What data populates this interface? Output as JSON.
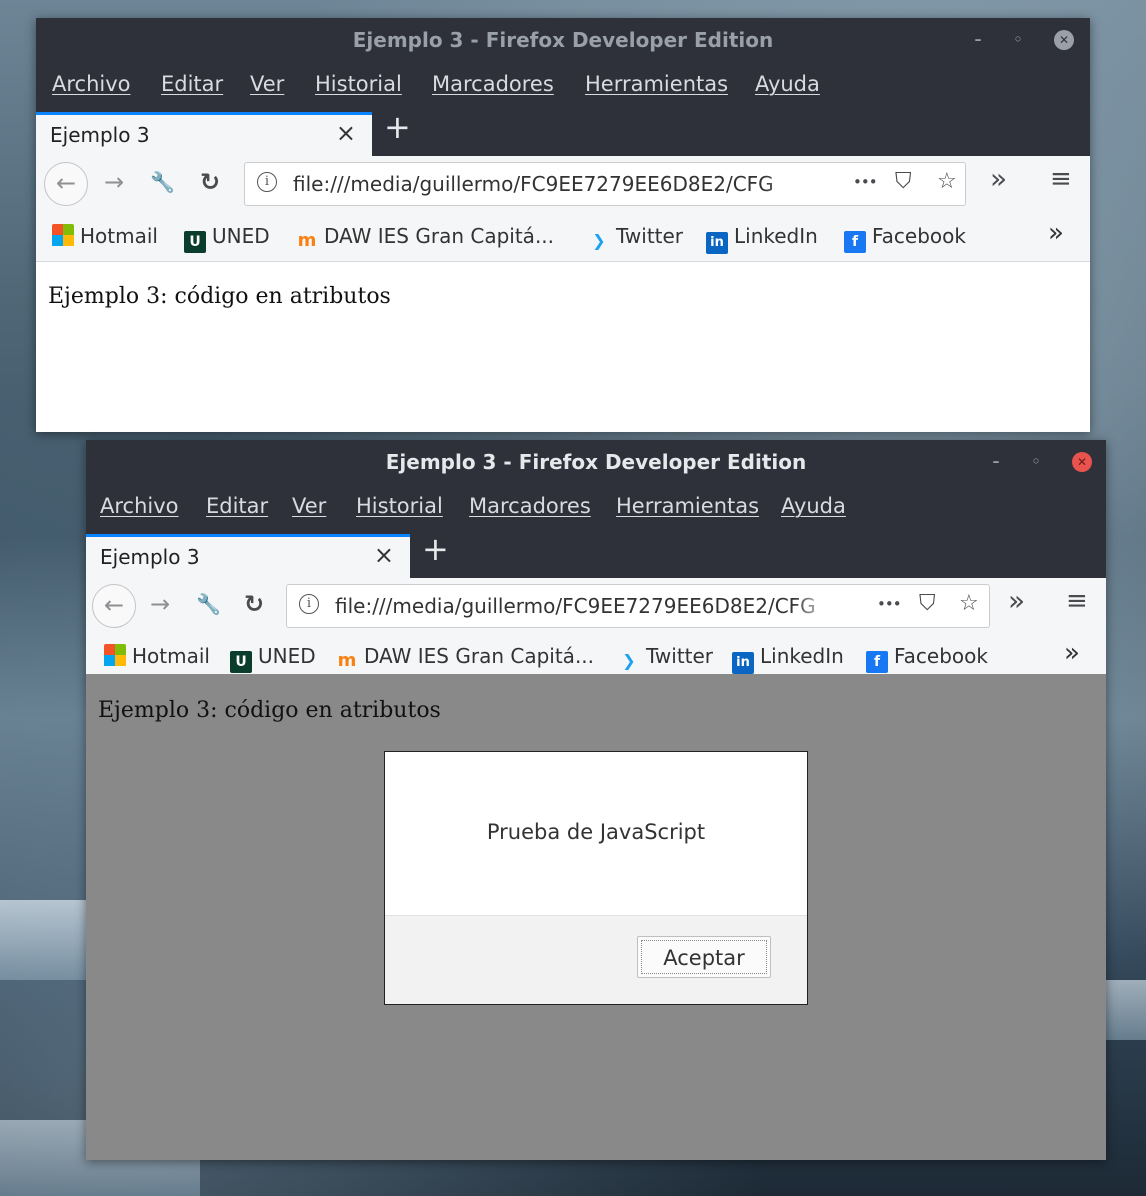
{
  "window_top": {
    "title": "Ejemplo 3 - Firefox Developer Edition",
    "controls": {
      "minimize": "–",
      "maximize": "◦",
      "close": "✕"
    },
    "menu": [
      "Archivo",
      "Editar",
      "Ver",
      "Historial",
      "Marcadores",
      "Herramientas",
      "Ayuda"
    ],
    "tab": {
      "title": "Ejemplo 3",
      "close": "×"
    },
    "new_tab": "+",
    "nav": {
      "back": "←",
      "forward": "→",
      "tools": "🔧",
      "reload": "↻",
      "overflow": "»",
      "hamburger": "≡"
    },
    "url": "file:///media/guillermo/FC9EE7279EE6D8E2/CFG",
    "url_icons": {
      "page_actions": "•••",
      "pocket": "⛉",
      "star": "☆"
    },
    "bookmarks": [
      {
        "label": "Hotmail",
        "icon": "windows-logo-icon"
      },
      {
        "label": "UNED",
        "icon": "uned-logo-icon"
      },
      {
        "label": "DAW IES Gran Capitá...",
        "icon": "moodle-icon"
      },
      {
        "label": "Twitter",
        "icon": "twitter-icon"
      },
      {
        "label": "LinkedIn",
        "icon": "linkedin-icon"
      },
      {
        "label": "Facebook",
        "icon": "facebook-icon"
      }
    ],
    "bookmarks_overflow": "»",
    "content_heading": "Ejemplo 3: código en atributos"
  },
  "window_bottom": {
    "title": "Ejemplo 3 - Firefox Developer Edition",
    "controls": {
      "minimize": "–",
      "maximize": "◦",
      "close": "✕"
    },
    "menu": [
      "Archivo",
      "Editar",
      "Ver",
      "Historial",
      "Marcadores",
      "Herramientas",
      "Ayuda"
    ],
    "tab": {
      "title": "Ejemplo 3",
      "close": "×"
    },
    "new_tab": "+",
    "nav": {
      "back": "←",
      "forward": "→",
      "tools": "🔧",
      "reload": "↻",
      "overflow": "»",
      "hamburger": "≡"
    },
    "url": "file:///media/guillermo/FC9EE7279EE6D8E2/CFG",
    "url_icons": {
      "page_actions": "•••",
      "pocket": "⛉",
      "star": "☆"
    },
    "bookmarks": [
      {
        "label": "Hotmail",
        "icon": "windows-logo-icon"
      },
      {
        "label": "UNED",
        "icon": "uned-logo-icon"
      },
      {
        "label": "DAW IES Gran Capitá...",
        "icon": "moodle-icon"
      },
      {
        "label": "Twitter",
        "icon": "twitter-icon"
      },
      {
        "label": "LinkedIn",
        "icon": "linkedin-icon"
      },
      {
        "label": "Facebook",
        "icon": "facebook-icon"
      }
    ],
    "bookmarks_overflow": "»",
    "content_heading": "Ejemplo 3: código en atributos",
    "dialog": {
      "message": "Prueba de JavaScript",
      "button": "Aceptar"
    }
  },
  "colors": {
    "close_active": "#e9534d",
    "tab_accent": "#0a84ff",
    "overlay": "#898989"
  }
}
